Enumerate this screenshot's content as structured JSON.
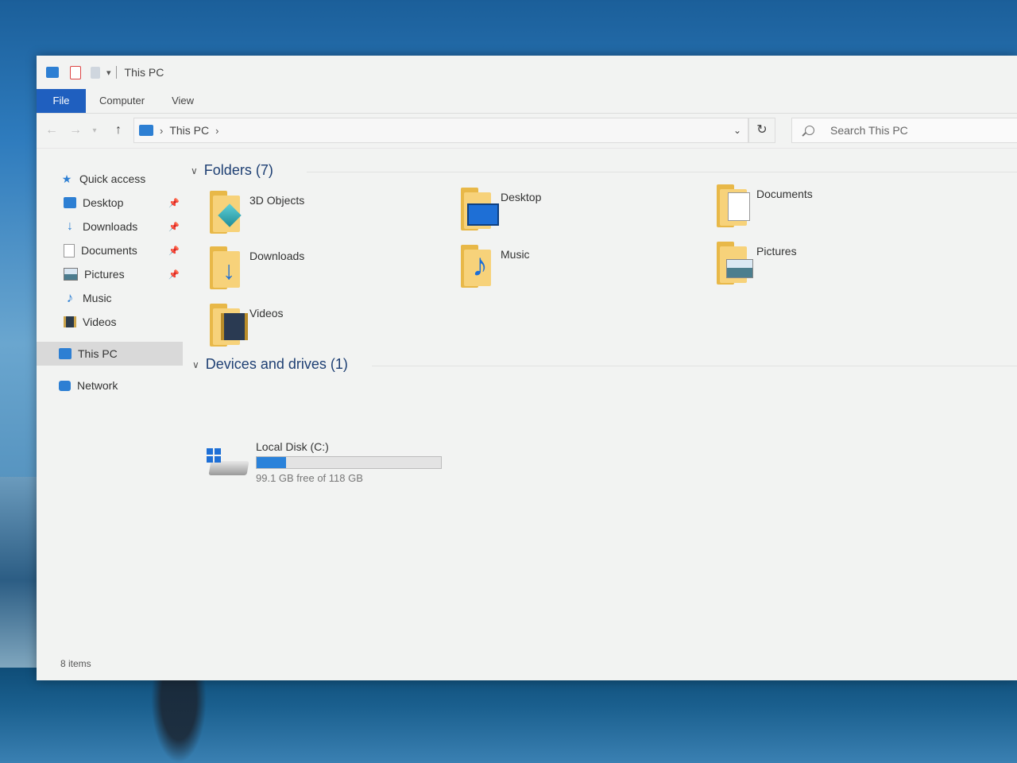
{
  "window": {
    "title": "This PC",
    "status": "8 items"
  },
  "ribbon": {
    "tabs": [
      {
        "label": "File"
      },
      {
        "label": "Computer"
      },
      {
        "label": "View"
      }
    ]
  },
  "address": {
    "path": "This PC",
    "search_placeholder": "Search This PC"
  },
  "nav": {
    "quick_access": "Quick access",
    "items": [
      {
        "label": "Desktop",
        "icon": "desktop-icon",
        "pinned": true
      },
      {
        "label": "Downloads",
        "icon": "downloads-icon",
        "pinned": true
      },
      {
        "label": "Documents",
        "icon": "documents-icon",
        "pinned": true
      },
      {
        "label": "Pictures",
        "icon": "pictures-icon",
        "pinned": true
      },
      {
        "label": "Music",
        "icon": "music-icon",
        "pinned": false
      },
      {
        "label": "Videos",
        "icon": "videos-icon",
        "pinned": false
      }
    ],
    "this_pc": "This PC",
    "network": "Network"
  },
  "content": {
    "folders_header": "Folders (7)",
    "folders": [
      {
        "label": "3D Objects"
      },
      {
        "label": "Desktop"
      },
      {
        "label": "Documents"
      },
      {
        "label": "Downloads"
      },
      {
        "label": "Music"
      },
      {
        "label": "Pictures"
      },
      {
        "label": "Videos"
      }
    ],
    "devices_header": "Devices and drives (1)",
    "drive": {
      "label": "Local Disk (C:)",
      "free_text": "99.1 GB free of 118 GB",
      "used_fraction": 0.16
    }
  },
  "colors": {
    "accent": "#1f5fbf",
    "folder": "#f7d27a",
    "drive_bar": "#2a82da"
  }
}
